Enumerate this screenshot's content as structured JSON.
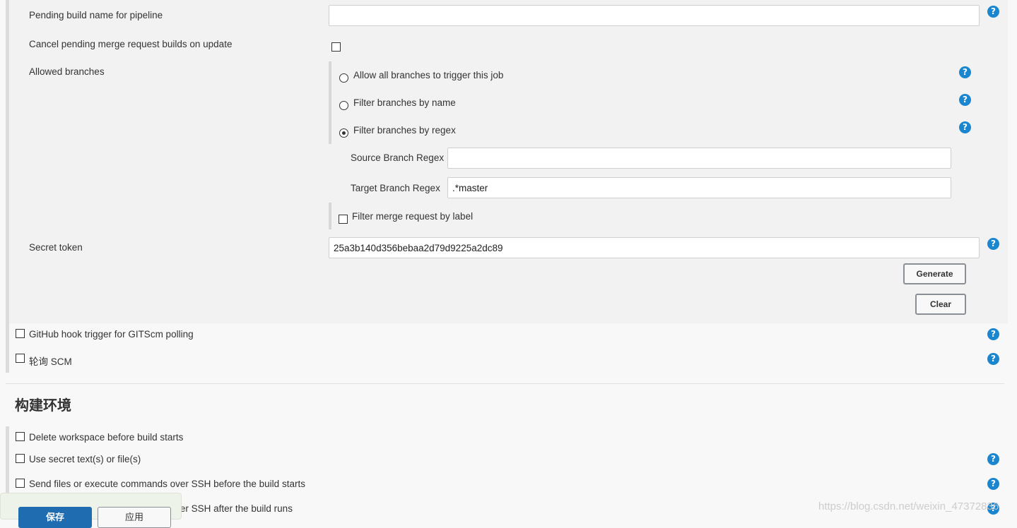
{
  "gitlab_trigger": {
    "pending_build_name_label": "Pending build name for pipeline",
    "pending_build_name_value": "",
    "cancel_pending_label": "Cancel pending merge request builds on update",
    "cancel_pending_checked": false,
    "allowed_branches_label": "Allowed branches",
    "branch_options": [
      {
        "label": "Allow all branches to trigger this job",
        "selected": false
      },
      {
        "label": "Filter branches by name",
        "selected": false
      },
      {
        "label": "Filter branches by regex",
        "selected": true
      }
    ],
    "source_branch_regex_label": "Source Branch Regex",
    "source_branch_regex_value": "",
    "target_branch_regex_label": "Target Branch Regex",
    "target_branch_regex_value": ".*master",
    "filter_mr_label": "Filter merge request by label",
    "secret_token_label": "Secret token",
    "secret_token_value": "25a3b140d356bebaa2d79d9225a2dc89",
    "generate_label": "Generate",
    "clear_label": "Clear"
  },
  "triggers": {
    "github_hook_label": "GitHub hook trigger for GITScm polling",
    "poll_scm_label": "轮询 SCM"
  },
  "build_env": {
    "title": "构建环境",
    "items": [
      {
        "label": "Delete workspace before build starts",
        "help": false
      },
      {
        "label": "Use secret text(s) or file(s)",
        "help": true
      },
      {
        "label": "Send files or execute commands over SSH before the build starts",
        "help": true
      },
      {
        "label": "Send files or execute commands over SSH after the build runs",
        "help": true
      }
    ]
  },
  "footer": {
    "save_label": "保存",
    "apply_label": "应用"
  },
  "watermark": "https://blog.csdn.net/weixin_47372836",
  "icons": {
    "help": "help-question-icon"
  },
  "colors": {
    "help_icon": "#1a86d0",
    "save_button": "#1f6cb0"
  }
}
